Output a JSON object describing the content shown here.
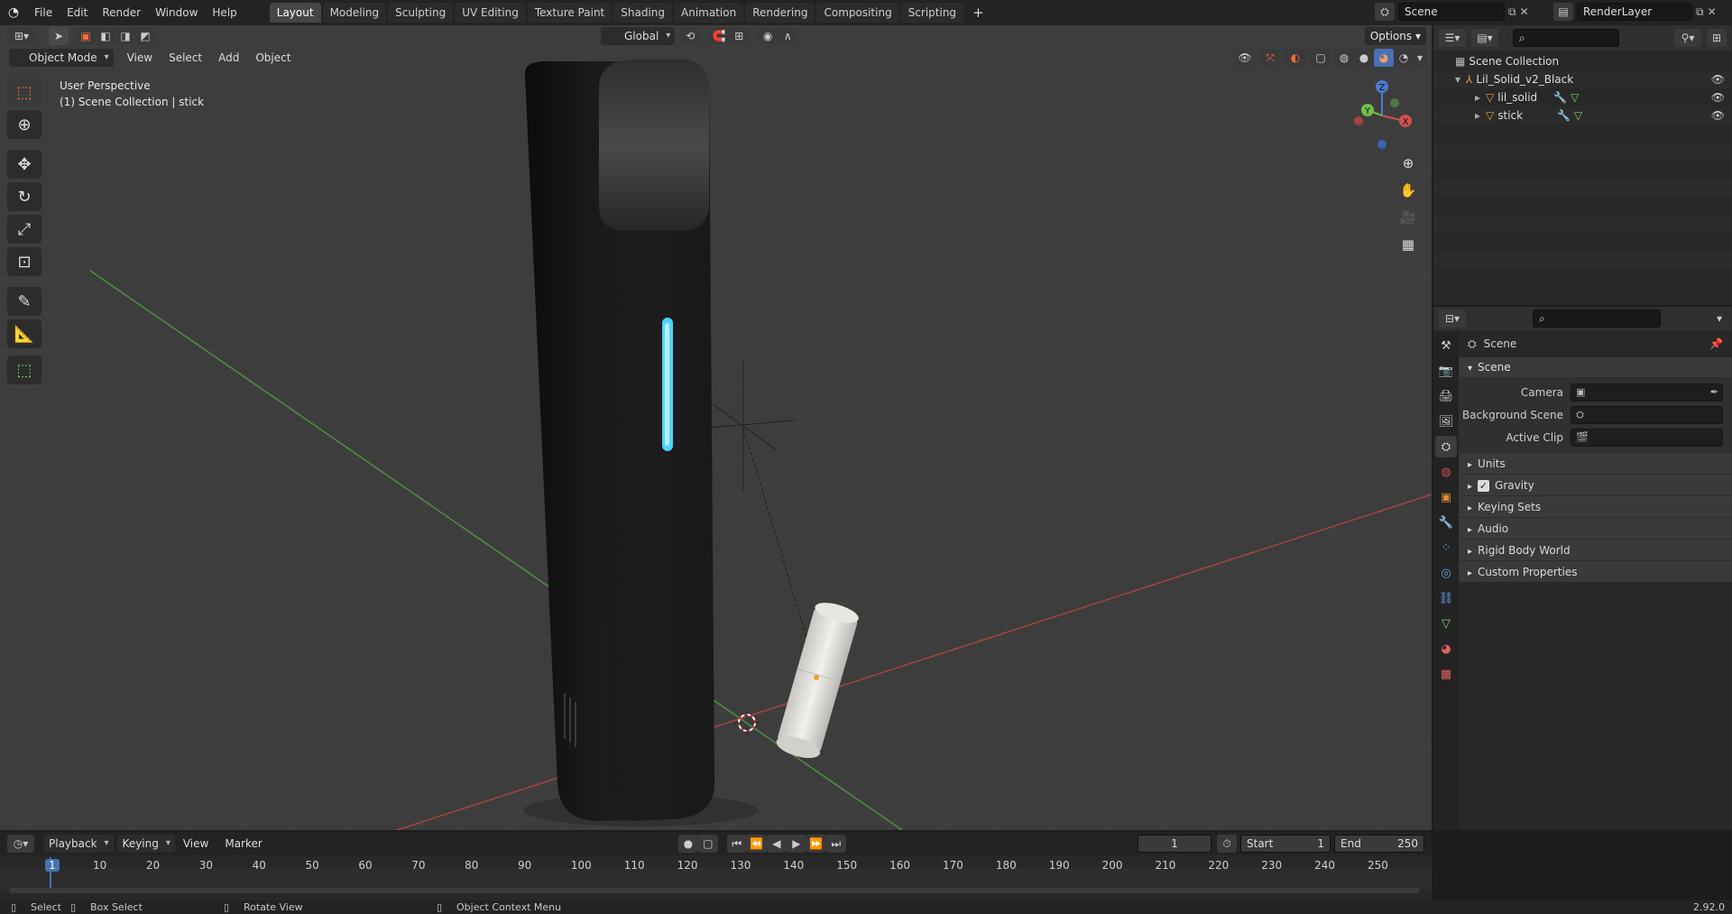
{
  "menu": [
    "File",
    "Edit",
    "Render",
    "Window",
    "Help"
  ],
  "workspaces": [
    "Layout",
    "Modeling",
    "Sculpting",
    "UV Editing",
    "Texture Paint",
    "Shading",
    "Animation",
    "Rendering",
    "Compositing",
    "Scripting"
  ],
  "add_tab": "+",
  "scene_field": "Scene",
  "renderlayer_field": "RenderLayer",
  "options_label": "Options",
  "transform_orientation": "Global",
  "mode_dropdown": "Object Mode",
  "viewport_menu": [
    "View",
    "Select",
    "Add",
    "Object"
  ],
  "viewport_info": {
    "line1": "User Perspective",
    "line2": "(1) Scene Collection | stick"
  },
  "gizmo": {
    "z": "Z",
    "y": "Y",
    "x": "X"
  },
  "outliner": {
    "root": "Scene Collection",
    "items": [
      {
        "label": "Lil_Solid_v2_Black"
      },
      {
        "label": "lil_solid"
      },
      {
        "label": "stick"
      }
    ]
  },
  "properties": {
    "header": "Scene",
    "panel": "Scene",
    "rows": [
      {
        "label": "Camera"
      },
      {
        "label": "Background Scene"
      },
      {
        "label": "Active Clip"
      }
    ],
    "subpanels": [
      "Units",
      "Gravity",
      "Keying Sets",
      "Audio",
      "Rigid Body World",
      "Custom Properties"
    ]
  },
  "timeline": {
    "menus": [
      "Playback",
      "Keying",
      "View",
      "Marker"
    ],
    "current_frame": "1",
    "start_label": "Start",
    "start_value": "1",
    "end_label": "End",
    "end_value": "250",
    "ticks": [
      "1",
      "10",
      "20",
      "30",
      "40",
      "50",
      "60",
      "70",
      "80",
      "90",
      "100",
      "110",
      "120",
      "130",
      "140",
      "150",
      "160",
      "170",
      "180",
      "190",
      "200",
      "210",
      "220",
      "230",
      "240",
      "250"
    ]
  },
  "statusbar": {
    "select": "Select",
    "box_select": "Box Select",
    "rotate_view": "Rotate View",
    "context_menu": "Object Context Menu",
    "version": "2.92.0"
  },
  "colors": {
    "accent": "#4772b3",
    "viewport_bg": "#3d3d3d",
    "device_light": "#4fd3ff",
    "axis_x": "#c04545",
    "axis_y": "#5ba04a"
  }
}
